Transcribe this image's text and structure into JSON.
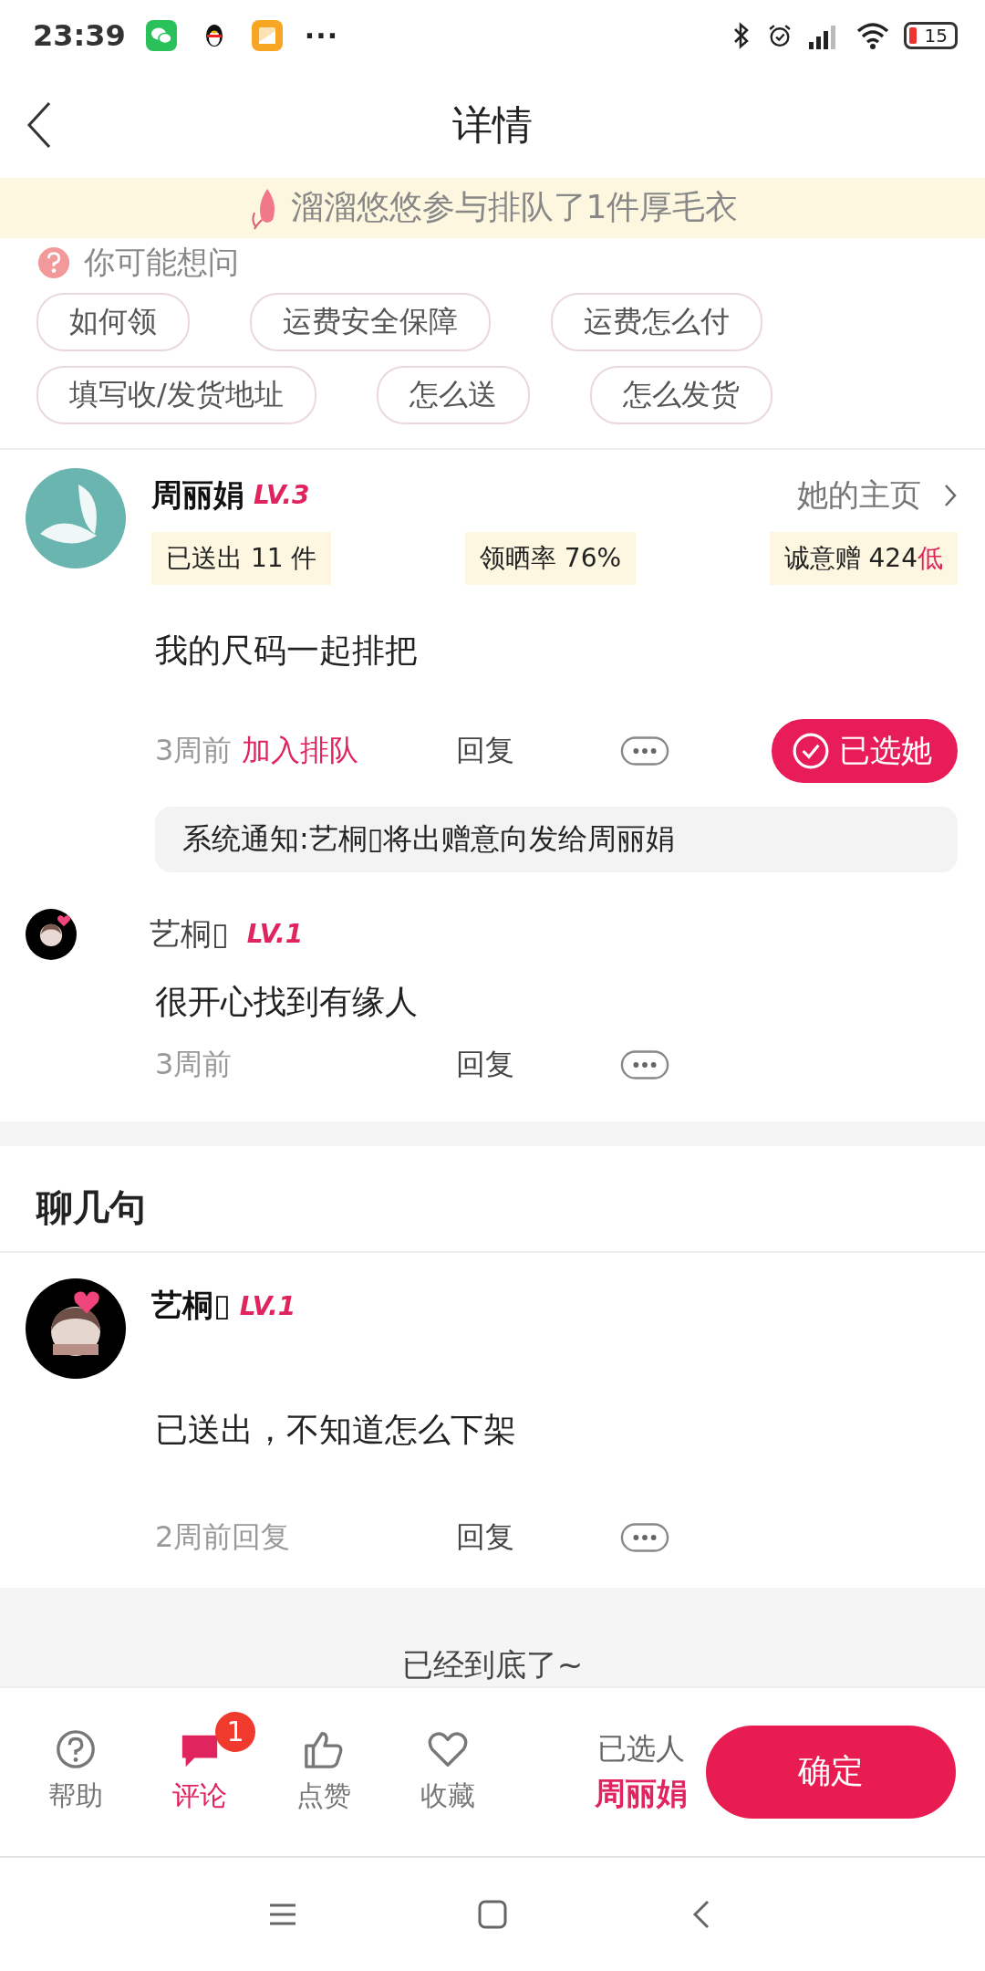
{
  "status_bar": {
    "time": "23:39",
    "more": "···",
    "battery": "15"
  },
  "header": {
    "title": "详情"
  },
  "faq": {
    "title": "你可能想问",
    "chips": [
      "如何领",
      "运费安全保障",
      "运费怎么付",
      "填写收/发货地址",
      "怎么送",
      "怎么发货"
    ]
  },
  "toast": {
    "text": "溜溜悠悠参与排队了1件厚毛衣"
  },
  "post": {
    "author": "周丽娟",
    "level": "LV.3",
    "profile_link": "她的主页",
    "stats": [
      {
        "label": "已送出 11 件"
      },
      {
        "label": "领晒率 76%"
      },
      {
        "label": "诚意赠 424",
        "tag": "低"
      }
    ],
    "comment": "我的尺码一起排把",
    "time": "3周前",
    "queue_link": "加入排队",
    "reply": "回复",
    "chosen_button": {
      "label": "已选她",
      "selected": true
    },
    "notice": "系统通知:艺桐▯将出赠意向发给周丽娟",
    "replies": [
      {
        "author": "艺桐▯",
        "level": "LV.1",
        "text": "很开心找到有缘人",
        "time": "3周前",
        "reply": "回复"
      }
    ]
  },
  "chat": {
    "title": "聊几句",
    "comments": [
      {
        "author": "艺桐▯",
        "level": "LV.1",
        "text": "已送出，不知道怎么下架",
        "time": "2周前回复",
        "reply": "回复"
      }
    ]
  },
  "end_note": "已经到底了~",
  "bottom_bar": {
    "actions": [
      {
        "kind": "help",
        "label": "帮助",
        "selected": false
      },
      {
        "kind": "comment",
        "label": "评论",
        "selected": true,
        "badge": "1"
      },
      {
        "kind": "like",
        "label": "点赞",
        "selected": false
      },
      {
        "kind": "favorite",
        "label": "收藏",
        "selected": false
      }
    ],
    "chosen_label": "已选人",
    "chosen_name": "周丽娟",
    "confirm": "确定"
  }
}
